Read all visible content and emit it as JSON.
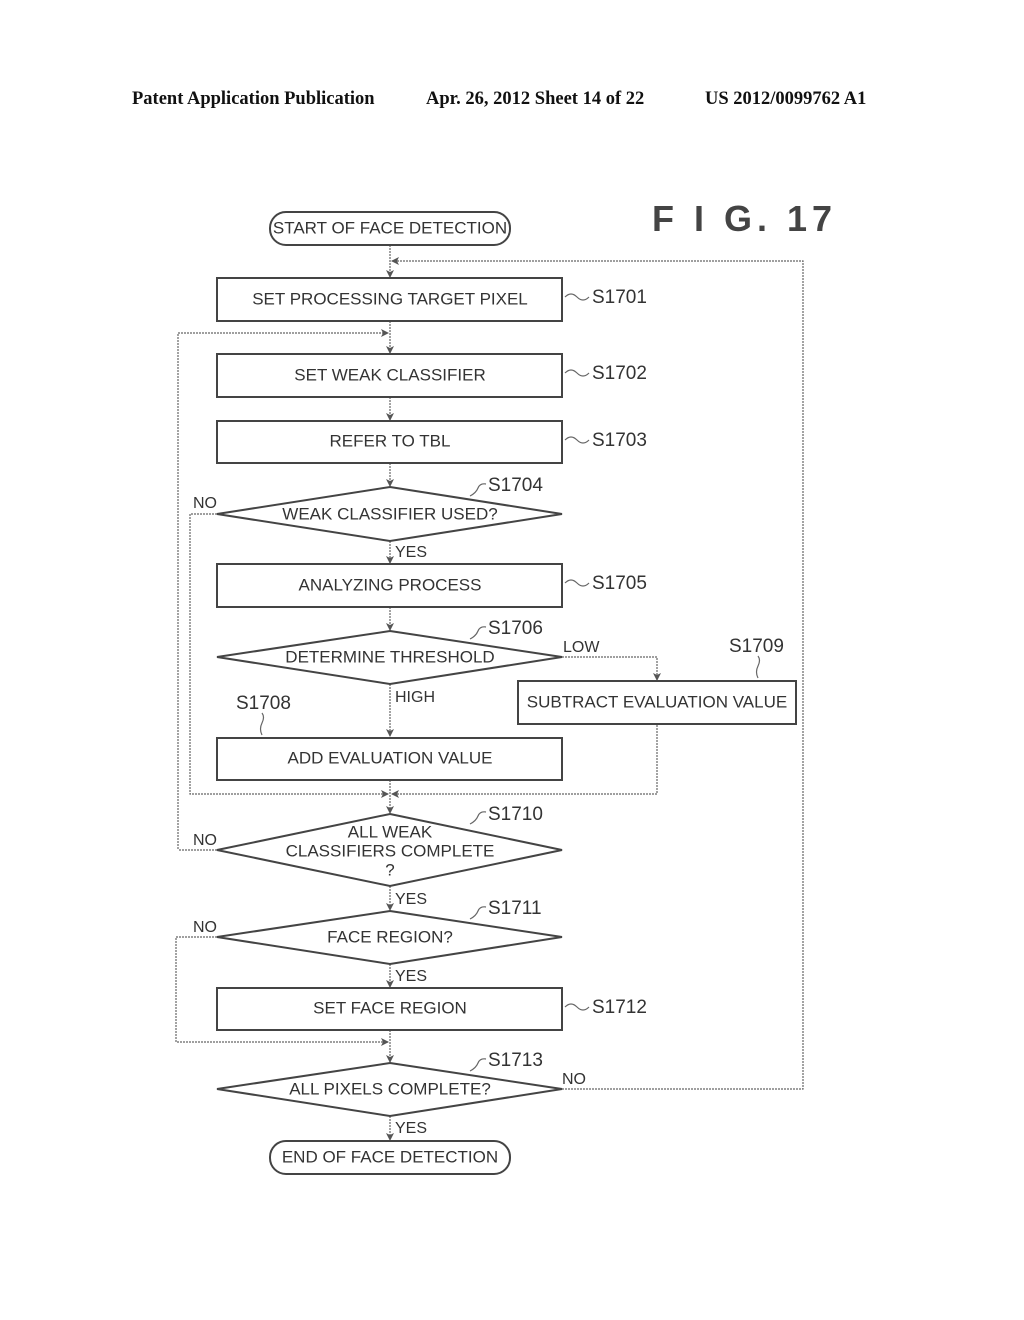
{
  "header": {
    "left": "Patent Application Publication",
    "middle": "Apr. 26, 2012  Sheet 14 of 22",
    "right": "US 2012/0099762 A1"
  },
  "figure": {
    "title": "F I G. 17"
  },
  "nodes": {
    "start": {
      "text": "START OF FACE DETECTION"
    },
    "s1701": {
      "text": "SET PROCESSING TARGET PIXEL",
      "step": "S1701"
    },
    "s1702": {
      "text": "SET WEAK CLASSIFIER",
      "step": "S1702"
    },
    "s1703": {
      "text": "REFER TO TBL",
      "step": "S1703"
    },
    "s1704": {
      "text": "WEAK CLASSIFIER USED?",
      "step": "S1704"
    },
    "s1705": {
      "text": "ANALYZING PROCESS",
      "step": "S1705"
    },
    "s1706": {
      "text": "DETERMINE THRESHOLD",
      "step": "S1706"
    },
    "s1708": {
      "text": "ADD EVALUATION VALUE",
      "step": "S1708"
    },
    "s1709": {
      "text": "SUBTRACT EVALUATION VALUE",
      "step": "S1709"
    },
    "s1710": {
      "text_lines": [
        "ALL WEAK",
        "CLASSIFIERS COMPLETE",
        "?"
      ],
      "step": "S1710"
    },
    "s1711": {
      "text": "FACE REGION?",
      "step": "S1711"
    },
    "s1712": {
      "text": "SET FACE REGION",
      "step": "S1712"
    },
    "s1713": {
      "text": "ALL PIXELS COMPLETE?",
      "step": "S1713"
    },
    "end": {
      "text": "END OF FACE DETECTION"
    }
  },
  "edges": {
    "s1704_no": "NO",
    "s1704_yes": "YES",
    "s1706_low": "LOW",
    "s1706_high": "HIGH",
    "s1710_no": "NO",
    "s1710_yes": "YES",
    "s1711_no": "NO",
    "s1711_yes": "YES",
    "s1713_no": "NO",
    "s1713_yes": "YES"
  }
}
